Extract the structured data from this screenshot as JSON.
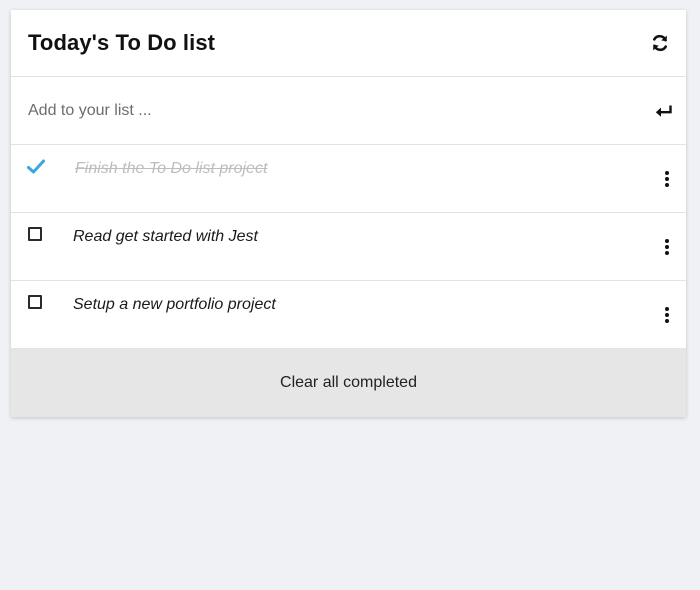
{
  "header": {
    "title": "Today's To Do list",
    "refresh_icon": "refresh-icon"
  },
  "add": {
    "placeholder": "Add to your list ...",
    "value": "",
    "submit_icon": "enter-icon"
  },
  "tasks": [
    {
      "text": "Finish the To Do list project",
      "completed": true
    },
    {
      "text": "Read get started with Jest",
      "completed": false
    },
    {
      "text": "Setup a new portfolio project",
      "completed": false
    }
  ],
  "footer": {
    "clear_label": "Clear all completed"
  },
  "colors": {
    "accent": "#3ba7e0",
    "completed_text": "#bdbdbd",
    "footer_bg": "#e6e6e6",
    "page_bg": "#f0f1f4"
  }
}
